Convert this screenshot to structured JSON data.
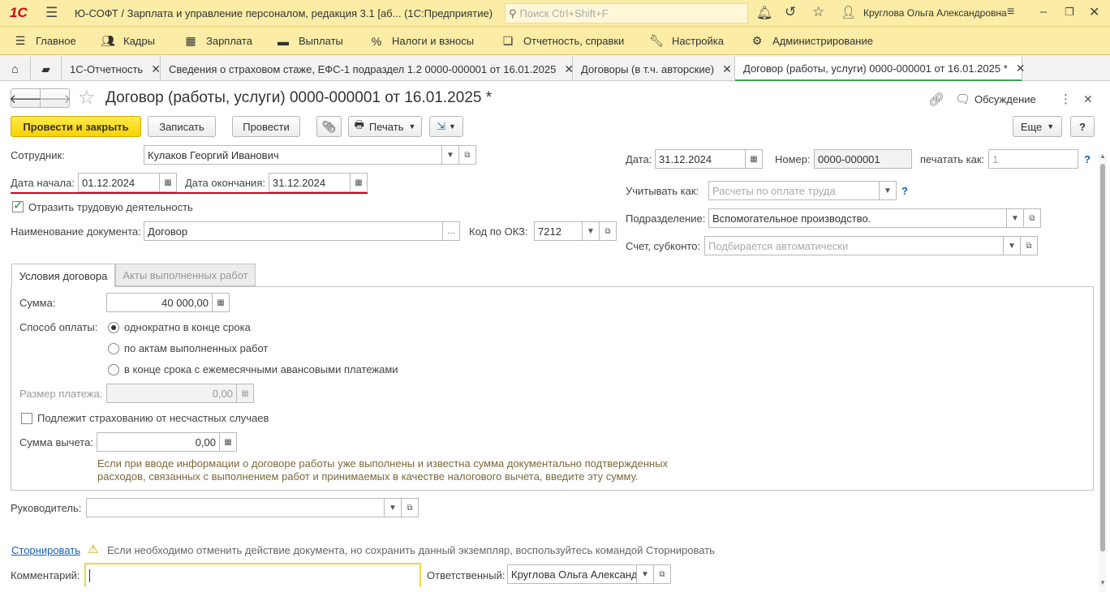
{
  "app": {
    "logo": "1С",
    "title": "Ю-СОФТ / Зарплата и управление персоналом, редакция 3.1 [аб...  (1С:Предприятие)",
    "search_placeholder": "Поиск Ctrl+Shift+F",
    "user": "Круглова Ольга Александровна"
  },
  "menu": {
    "items": [
      {
        "label": "Главное",
        "icon": "hamburger-icon"
      },
      {
        "label": "Кадры",
        "icon": "people-icon"
      },
      {
        "label": "Зарплата",
        "icon": "calculator-icon"
      },
      {
        "label": "Выплаты",
        "icon": "wallet-icon"
      },
      {
        "label": "Налоги и взносы",
        "icon": "percent-icon"
      },
      {
        "label": "Отчетность, справки",
        "icon": "report-icon"
      },
      {
        "label": "Настройка",
        "icon": "wrench-icon"
      },
      {
        "label": "Администрирование",
        "icon": "gear-icon"
      }
    ]
  },
  "tabs": [
    {
      "label": "1С-Отчетность"
    },
    {
      "label": "Сведения о страховом стаже, ЕФС-1 подраздел 1.2 0000-000001 от 16.01.2025"
    },
    {
      "label": "Договоры (в т.ч. авторские)"
    },
    {
      "label": "Договор (работы, услуги) 0000-000001 от 16.01.2025 *"
    }
  ],
  "doc": {
    "title": "Договор (работы, услуги) 0000-000001 от 16.01.2025 *",
    "discussion": "Обсуждение"
  },
  "toolbar": {
    "post_close": "Провести и закрыть",
    "save": "Записать",
    "post": "Провести",
    "print": "Печать",
    "more": "Еще",
    "help": "?"
  },
  "form": {
    "employee_label": "Сотрудник:",
    "employee_value": "Кулаков Георгий Иванович",
    "start_label": "Дата начала:",
    "start_value": "01.12.2024",
    "end_label": "Дата окончания:",
    "end_value": "31.12.2024",
    "reflect_label": "Отразить трудовую деятельность",
    "docname_label": "Наименование документа:",
    "docname_value": "Договор",
    "okz_label": "Код по ОКЗ:",
    "okz_value": "7212",
    "date_label": "Дата:",
    "date_value": "31.12.2024",
    "number_label": "Номер:",
    "number_value": "0000-000001",
    "print_as_label": "печатать как:",
    "print_as_placeholder": "1",
    "account_as_label": "Учитывать как:",
    "account_as_placeholder": "Расчеты по оплате труда",
    "dept_label": "Подразделение:",
    "dept_value": "Вспомогательное производство.",
    "subconto_label": "Счет, субконто:",
    "subconto_placeholder": "Подбирается автоматически",
    "q": "?"
  },
  "inner_tabs": [
    {
      "label": "Условия договора"
    },
    {
      "label": "Акты выполненных работ"
    }
  ],
  "conditions": {
    "sum_label": "Сумма:",
    "sum_value": "40 000,00",
    "payment_label": "Способ оплаты:",
    "options": [
      "однократно в конце срока",
      "по актам выполненных работ",
      "в конце срока с ежемесячными авансовыми платежами"
    ],
    "payment_size_label": "Размер платежа:",
    "payment_size_value": "0,00",
    "insurance_label": "Подлежит страхованию от несчастных случаев",
    "deduction_label": "Сумма вычета:",
    "deduction_value": "0,00",
    "hint_line1": "Если при вводе информации о договоре работы уже выполнены и известна сумма документально подтвержденных",
    "hint_line2": "расходов, связанных с выполнением работ и принимаемых в качестве налогового вычета, введите эту сумму."
  },
  "footer": {
    "manager_label": "Руководитель:",
    "storno_link": "Сторнировать",
    "storno_hint": "Если необходимо отменить действие документа, но сохранить данный экземпляр, воспользуйтесь командой Сторнировать",
    "comment_label": "Комментарий:",
    "responsible_label": "Ответственный:",
    "responsible_value": "Круглова Ольга Александ"
  },
  "colors": {
    "accent_yellow": "#fbeca6",
    "primary_button": "#f8d300",
    "underline_red": "#d0021b",
    "active_tab_green": "#3aa655",
    "link_blue": "#1a5fb4"
  }
}
